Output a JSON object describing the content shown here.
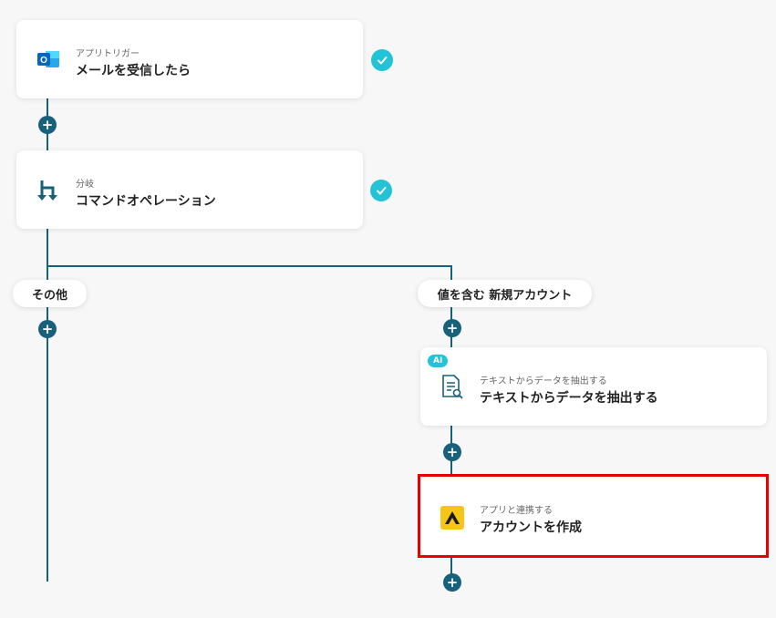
{
  "nodes": {
    "trigger": {
      "category": "アプリトリガー",
      "title": "メールを受信したら",
      "icon": "outlook-icon"
    },
    "branch": {
      "category": "分岐",
      "title": "コマンドオペレーション",
      "icon": "branch-icon"
    },
    "extract": {
      "category": "テキストからデータを抽出する",
      "title": "テキストからデータを抽出する",
      "icon": "document-search-icon",
      "badge": "AI"
    },
    "create": {
      "category": "アプリと連携する",
      "title": "アカウントを作成",
      "icon": "app-logo-icon"
    }
  },
  "branches": {
    "other": "その他",
    "match": "値を含む 新規アカウント"
  },
  "add_step_glyph": "+",
  "colors": {
    "connector": "#17627a",
    "check": "#22c3d6",
    "highlight": "#e60000",
    "app_logo": "#f5c518"
  }
}
